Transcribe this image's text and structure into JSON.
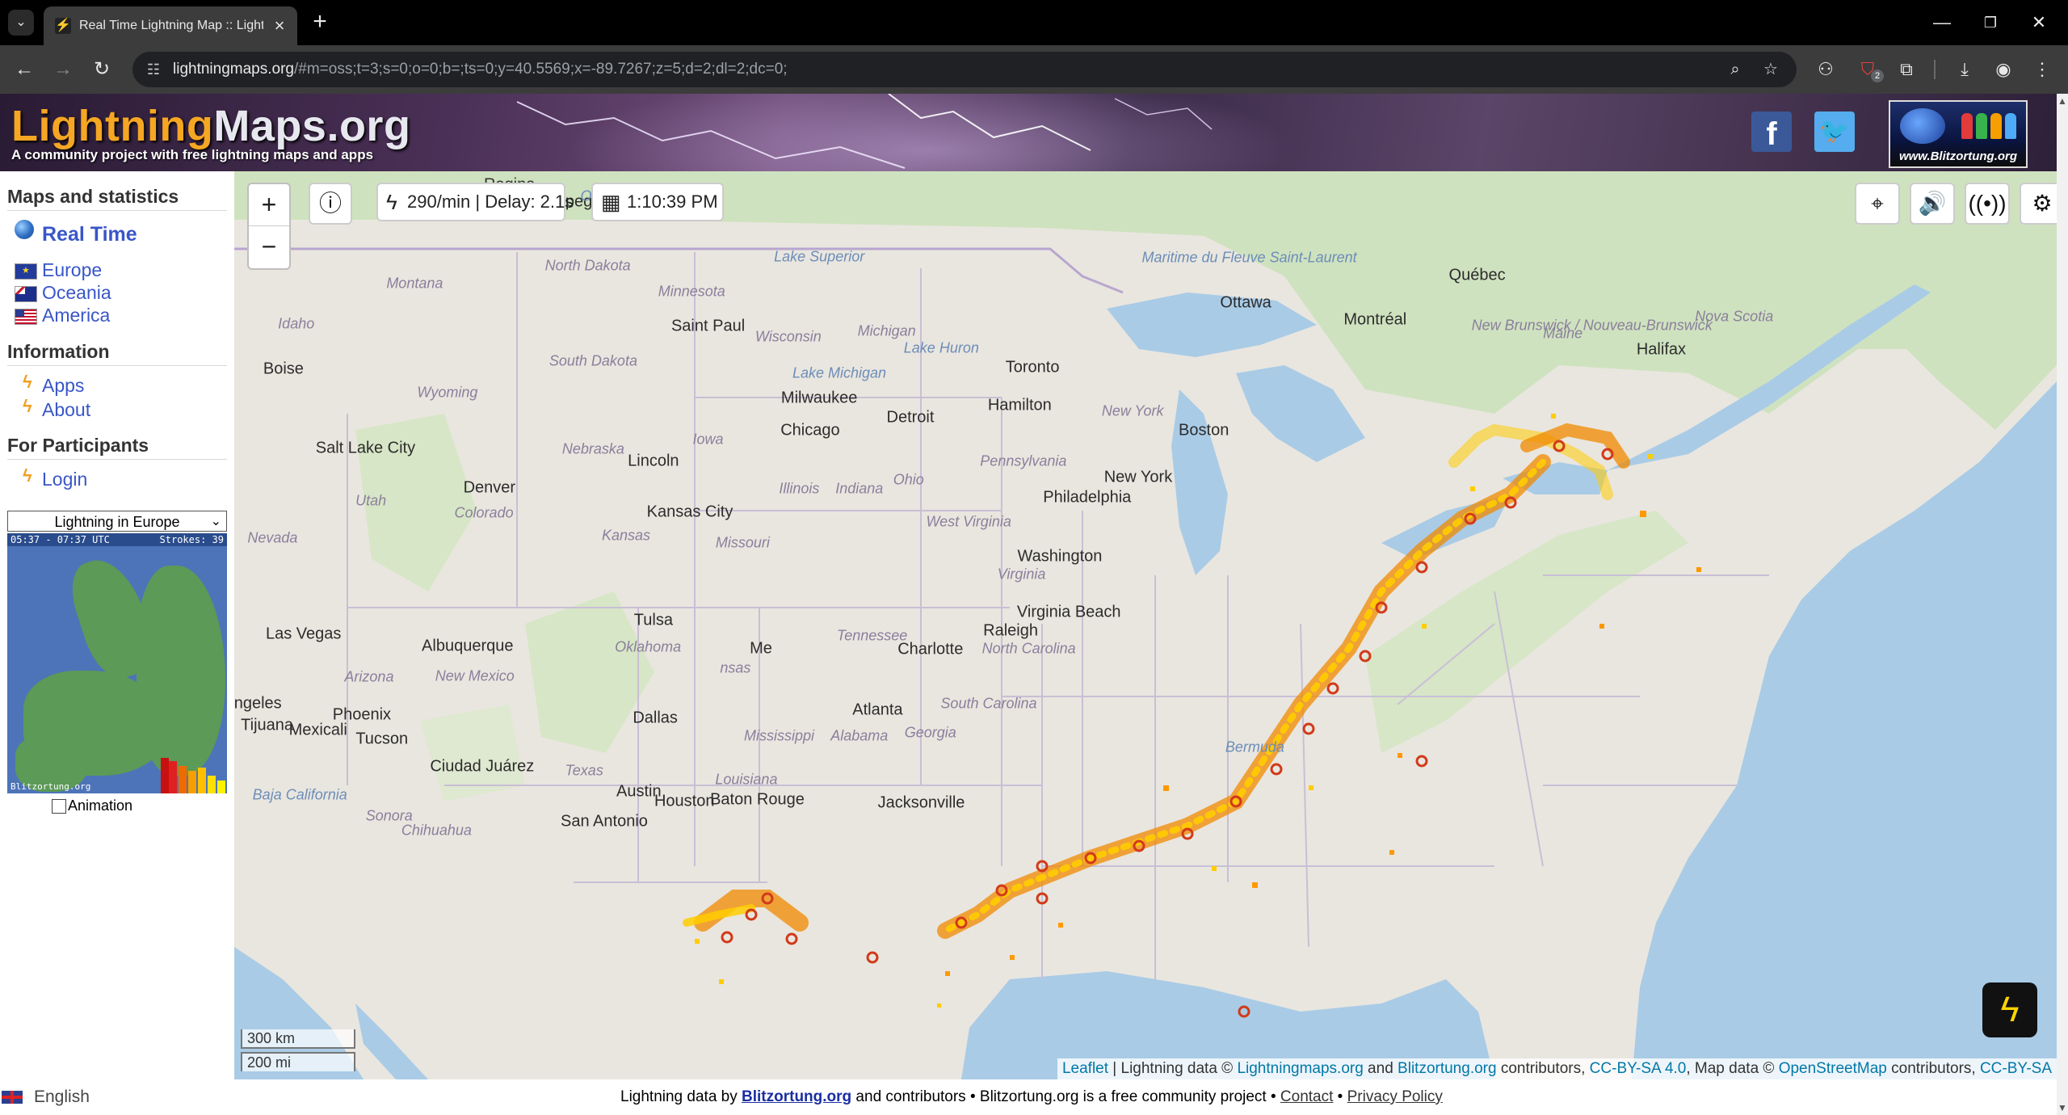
{
  "browser": {
    "tab_title": "Real Time Lightning Map :: Lightning",
    "url_host": "lightningmaps.org",
    "url_rest": "/#m=oss;t=3;s=0;o=0;b=;ts=0;y=40.5569;x=-89.7267;z=5;d=2;dl=2;dc=0;",
    "extension_badge": "2",
    "icons": [
      "tab-list-icon",
      "favicon-bolt-icon",
      "close-icon",
      "new-tab-icon",
      "back-icon",
      "forward-icon",
      "reload-icon",
      "site-info-icon",
      "zoom-icon",
      "star-icon",
      "extension-icon",
      "puzzle-icon",
      "download-icon",
      "profile-icon",
      "menu-icon"
    ]
  },
  "header": {
    "logo_part1": "Lightning",
    "logo_part2": "Maps.org",
    "tagline": "A community project with free lightning maps and apps",
    "facebook_label": "f",
    "twitter_label": "🐦",
    "blitz_logo_text": "www.Blitzortung.org"
  },
  "sidebar": {
    "maps_heading": "Maps and statistics",
    "real_time": "Real Time",
    "regions": [
      "Europe",
      "Oceania",
      "America"
    ],
    "info_heading": "Information",
    "info_links": [
      "Apps",
      "About"
    ],
    "participants_heading": "For Participants",
    "login": "Login",
    "select_value": "Lightning in Europe",
    "minimap_time": "05:37 - 07:37 UTC",
    "minimap_strokes": "Strokes: 39",
    "minimap_footer": "Blitzortung.org",
    "animation_label": "Animation"
  },
  "map": {
    "rate": "290/min | Delay: 2.1s",
    "time": "1:10:39 PM",
    "zoom_in": "+",
    "zoom_out": "−",
    "scale_km": "300 km",
    "scale_mi": "200 mi",
    "labels": {
      "regina": "Regina",
      "winnipeg": "Winnipeg",
      "ontario": "Ontario",
      "quebec_region": "Québec",
      "nd": "North Dakota",
      "montana": "Montana",
      "minnesota": "Minnesota",
      "lake_superior": "Lake Superior",
      "saint_paul": "Saint Paul",
      "wisconsin": "Wisconsin",
      "michigan": "Michigan",
      "lake_huron": "Lake Huron",
      "ottawa": "Ottawa",
      "montreal": "Montréal",
      "quebec_city": "Québec",
      "maine": "Maine",
      "halifax": "Halifax",
      "nova_scotia": "Nova Scotia",
      "nb": "New Brunswick / Nouveau-Brunswick",
      "maritime": "Maritime du Fleuve Saint-Laurent",
      "idaho": "Idaho",
      "boise": "Boise",
      "sd": "South Dakota",
      "wyoming": "Wyoming",
      "lake_michigan": "Lake Michigan",
      "milwaukee": "Milwaukee",
      "toronto": "Toronto",
      "hamilton": "Hamilton",
      "detroit": "Detroit",
      "new_york_state": "New York",
      "boston": "Boston",
      "chicago": "Chicago",
      "iowa": "Iowa",
      "slc": "Salt Lake City",
      "nebraska": "Nebraska",
      "lincoln": "Lincoln",
      "pennsylvania": "Pennsylvania",
      "new_york_city": "New York",
      "denver": "Denver",
      "utah": "Utah",
      "colorado": "Colorado",
      "ohio": "Ohio",
      "illinois": "Illinois",
      "indiana": "Indiana",
      "philadelphia": "Philadelphia",
      "kansas_city": "Kansas City",
      "kansas": "Kansas",
      "missouri": "Missouri",
      "west_virginia": "West Virginia",
      "washington": "Washington",
      "virginia": "Virginia",
      "nevada": "Nevada",
      "virginia_beach": "Virginia Beach",
      "tulsa": "Tulsa",
      "las_vegas": "Las Vegas",
      "albuquerque": "Albuquerque",
      "oklahoma": "Oklahoma",
      "tennessee": "Tennessee",
      "raleigh": "Raleigh",
      "charlotte": "Charlotte",
      "north_carolina": "North Carolina",
      "arizona": "Arizona",
      "new_mexico": "New Mexico",
      "memphis": "Me",
      "arkansas": "nsas",
      "los_angeles": "Angeles",
      "phoenix": "Phoenix",
      "dallas": "Dallas",
      "atlanta": "Atlanta",
      "south_carolina": "South Carolina",
      "tijuana": "Tijuana",
      "mexicali": "Mexicali",
      "tucson": "Tucson",
      "mississippi": "Mississippi",
      "alabama": "Alabama",
      "georgia": "Georgia",
      "bermuda": "Bermuda",
      "ciudad_juarez": "Ciudad Juárez",
      "texas": "Texas",
      "louisiana": "Louisiana",
      "baja": "Baja California",
      "austin": "Austin",
      "houston": "Houston",
      "baton_rouge": "Baton Rouge",
      "jacksonville": "Jacksonville",
      "sonora": "Sonora",
      "san_antonio": "San Antonio",
      "chihuahua": "Chihuahua"
    },
    "attribution": {
      "leaflet": "Leaflet",
      "part1": " | Lightning data © ",
      "lightningmaps": "Lightningmaps.org",
      "part2": " and ",
      "blitzortung": "Blitzortung.org",
      "part3": " contributors, ",
      "ccbysa40": "CC-BY-SA 4.0",
      "part4": ", Map data © ",
      "osm": "OpenStreetMap",
      "part5": " contributors, ",
      "ccbysa": "CC-BY-SA"
    },
    "colors": {
      "water": "#a9cbe6",
      "land": "#ece9e2",
      "forest": "#cfe2bf",
      "strike_yellow": "#ffcc00",
      "strike_orange": "#f08a00",
      "strike_red": "#d23a1a"
    }
  },
  "footer": {
    "language": "English",
    "text1": "Lightning data by ",
    "blitzortung": "Blitzortung.org",
    "text2": " and contributors • Blitzortung.org is a free community project • ",
    "contact": "Contact",
    "sep": " • ",
    "privacy": "Privacy Policy"
  }
}
